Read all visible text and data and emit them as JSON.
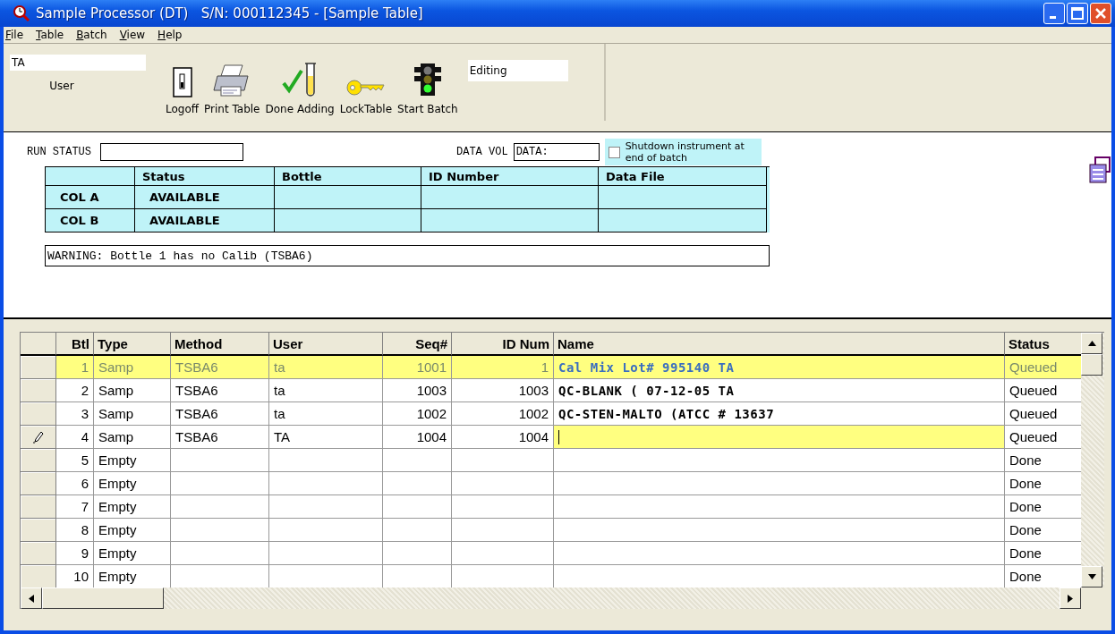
{
  "window": {
    "title": "Sample Processor (DT)   S/N: 000112345 - [Sample Table]"
  },
  "menu": [
    {
      "label": "File"
    },
    {
      "label": "Table"
    },
    {
      "label": "Batch"
    },
    {
      "label": "View"
    },
    {
      "label": "Help"
    }
  ],
  "toolbar": {
    "user_field": {
      "value": "TA"
    },
    "user_label": "User",
    "buttons": [
      {
        "kind": "logoff",
        "label": "Logoff"
      },
      {
        "kind": "print",
        "label": "Print Table"
      },
      {
        "kind": "done",
        "label": "Done Adding"
      },
      {
        "kind": "lock",
        "label": "LockTable"
      },
      {
        "kind": "start",
        "label": "Start Batch"
      }
    ],
    "mode_field": {
      "value": "Editing"
    }
  },
  "run_panel": {
    "run_status_label": "RUN STATUS",
    "data_vol_label": "DATA VOL",
    "data_vol_value": "DATA:",
    "shutdown": {
      "label": "Shutdown instrument at end of batch",
      "checked": false
    },
    "columns": [
      null,
      "Status",
      "Bottle",
      "ID Number",
      "Data File"
    ],
    "rows": [
      {
        "cells": [
          "COL A",
          "AVAILABLE",
          null,
          null,
          null
        ]
      },
      {
        "cells": [
          "COL B",
          "AVAILABLE",
          null,
          null,
          null
        ]
      }
    ],
    "warning": "WARNING: Bottle 1 has no Calib (TSBA6)"
  },
  "grid": {
    "columns": [
      "Btl",
      "Type",
      "Method",
      "User",
      "Seq#",
      "ID Num",
      "Name",
      "Status"
    ],
    "rows": [
      {
        "selected": true,
        "editing": false,
        "cells": [
          "1",
          "Samp",
          "TSBA6",
          "ta",
          "1001",
          "1",
          "Cal Mix Lot# 995140 TA",
          "Queued"
        ]
      },
      {
        "selected": false,
        "editing": false,
        "cells": [
          "2",
          "Samp",
          "TSBA6",
          "ta",
          "1003",
          "1003",
          "QC-BLANK (  07-12-05 TA",
          "Queued"
        ]
      },
      {
        "selected": false,
        "editing": false,
        "cells": [
          "3",
          "Samp",
          "TSBA6",
          "ta",
          "1002",
          "1002",
          "QC-STEN-MALTO (ATCC # 13637",
          "Queued"
        ]
      },
      {
        "selected": false,
        "editing": true,
        "cells": [
          "4",
          "Samp",
          "TSBA6",
          "TA",
          "1004",
          "1004",
          null,
          "Queued"
        ]
      },
      {
        "selected": false,
        "editing": false,
        "cells": [
          "5",
          "Empty",
          null,
          null,
          null,
          null,
          null,
          "Done"
        ]
      },
      {
        "selected": false,
        "editing": false,
        "cells": [
          "6",
          "Empty",
          null,
          null,
          null,
          null,
          null,
          "Done"
        ]
      },
      {
        "selected": false,
        "editing": false,
        "cells": [
          "7",
          "Empty",
          null,
          null,
          null,
          null,
          null,
          "Done"
        ]
      },
      {
        "selected": false,
        "editing": false,
        "cells": [
          "8",
          "Empty",
          null,
          null,
          null,
          null,
          null,
          "Done"
        ]
      },
      {
        "selected": false,
        "editing": false,
        "cells": [
          "9",
          "Empty",
          null,
          null,
          null,
          null,
          null,
          "Done"
        ]
      },
      {
        "selected": false,
        "editing": false,
        "cells": [
          "10",
          "Empty",
          null,
          null,
          null,
          null,
          null,
          "Done"
        ]
      }
    ]
  }
}
